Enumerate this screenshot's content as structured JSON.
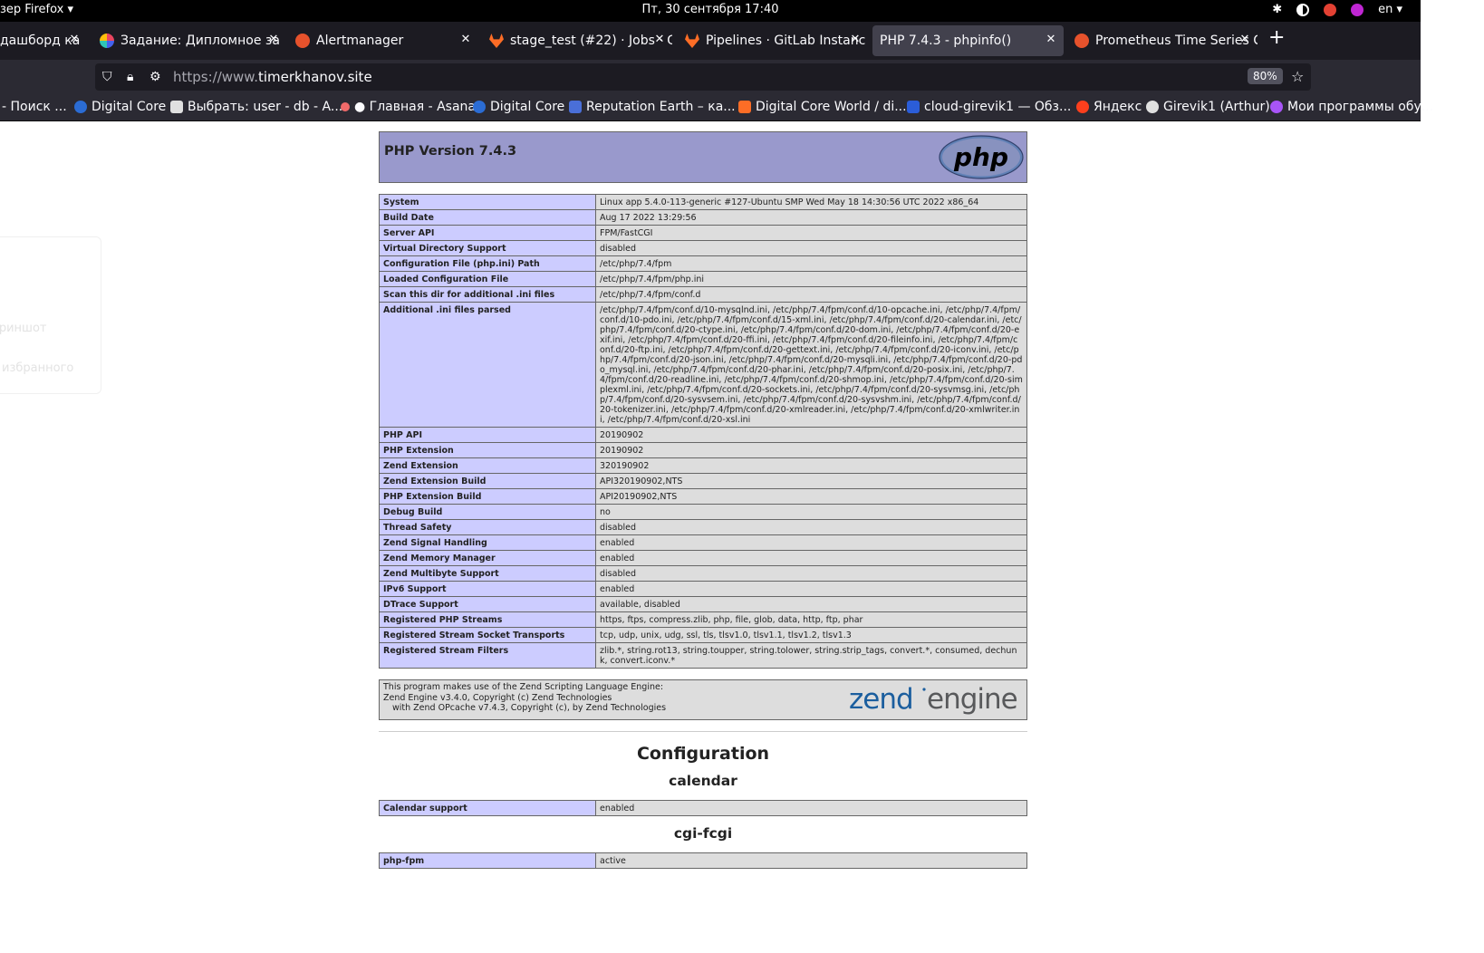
{
  "topbar": {
    "app_name": "зер Firefox ▾",
    "clock": "Пт, 30 сентября  17:40",
    "lang": "en ▾"
  },
  "tabs": [
    {
      "title": "дашборд ка",
      "favicon_color": "#555555"
    },
    {
      "title": "Задание: Дипломное за",
      "favicon_color": "#8a63d2"
    },
    {
      "title": "Alertmanager",
      "favicon_color": "#e6522c"
    },
    {
      "title": "stage_test (#22) · Jobs · G",
      "favicon_color": "#fc6d26"
    },
    {
      "title": "Pipelines · GitLab Instanc",
      "favicon_color": "#fc6d26"
    },
    {
      "title": "PHP 7.4.3 - phpinfo()",
      "favicon_color": ""
    },
    {
      "title": "Prometheus Time Series C",
      "favicon_color": "#e6522c"
    }
  ],
  "navbar": {
    "url_prefix": "https://www.",
    "url_domain": "timerkhanov.site",
    "zoom": "80%"
  },
  "bookmarks": [
    {
      "label": "- Поиск ...",
      "color": ""
    },
    {
      "label": "Digital Core",
      "color": "#2b6cd4"
    },
    {
      "label": "Выбрать: user - db - A...",
      "color": "#e0e0e0"
    },
    {
      "label": "● Главная - Asana",
      "color": "#f06a6a"
    },
    {
      "label": "Digital Core",
      "color": "#2b6cd4"
    },
    {
      "label": "Reputation Earth – ка...",
      "color": "#4a6fd8"
    },
    {
      "label": "Digital Core World / di...",
      "color": "#fc6d26"
    },
    {
      "label": "cloud-girevik1 — Обз...",
      "color": "#2b5dd8"
    },
    {
      "label": "Яндекс",
      "color": "#fc3f1d"
    },
    {
      "label": "Girevik1 (Arthur)",
      "color": "#e0e0e0"
    },
    {
      "label": "Мои программы обу...",
      "color": "#a855f7"
    }
  ],
  "ghost_menu": [
    "о",
    "а",
    "криншот",
    "з избранного"
  ],
  "phpinfo": {
    "version_title": "PHP Version 7.4.3",
    "logo_text": "php",
    "rows": [
      {
        "k": "System",
        "v": "Linux app 5.4.0-113-generic #127-Ubuntu SMP Wed May 18 14:30:56 UTC 2022 x86_64"
      },
      {
        "k": "Build Date",
        "v": "Aug 17 2022 13:29:56"
      },
      {
        "k": "Server API",
        "v": "FPM/FastCGI"
      },
      {
        "k": "Virtual Directory Support",
        "v": "disabled"
      },
      {
        "k": "Configuration File (php.ini) Path",
        "v": "/etc/php/7.4/fpm"
      },
      {
        "k": "Loaded Configuration File",
        "v": "/etc/php/7.4/fpm/php.ini"
      },
      {
        "k": "Scan this dir for additional .ini files",
        "v": "/etc/php/7.4/fpm/conf.d"
      },
      {
        "k": "Additional .ini files parsed",
        "v": "/etc/php/7.4/fpm/conf.d/10-mysqlnd.ini, /etc/php/7.4/fpm/conf.d/10-opcache.ini, /etc/php/7.4/fpm/conf.d/10-pdo.ini, /etc/php/7.4/fpm/conf.d/15-xml.ini, /etc/php/7.4/fpm/conf.d/20-calendar.ini, /etc/php/7.4/fpm/conf.d/20-ctype.ini, /etc/php/7.4/fpm/conf.d/20-dom.ini, /etc/php/7.4/fpm/conf.d/20-exif.ini, /etc/php/7.4/fpm/conf.d/20-ffi.ini, /etc/php/7.4/fpm/conf.d/20-fileinfo.ini, /etc/php/7.4/fpm/conf.d/20-ftp.ini, /etc/php/7.4/fpm/conf.d/20-gettext.ini, /etc/php/7.4/fpm/conf.d/20-iconv.ini, /etc/php/7.4/fpm/conf.d/20-json.ini, /etc/php/7.4/fpm/conf.d/20-mysqli.ini, /etc/php/7.4/fpm/conf.d/20-pdo_mysql.ini, /etc/php/7.4/fpm/conf.d/20-phar.ini, /etc/php/7.4/fpm/conf.d/20-posix.ini, /etc/php/7.4/fpm/conf.d/20-readline.ini, /etc/php/7.4/fpm/conf.d/20-shmop.ini, /etc/php/7.4/fpm/conf.d/20-simplexml.ini, /etc/php/7.4/fpm/conf.d/20-sockets.ini, /etc/php/7.4/fpm/conf.d/20-sysvmsg.ini, /etc/php/7.4/fpm/conf.d/20-sysvsem.ini, /etc/php/7.4/fpm/conf.d/20-sysvshm.ini, /etc/php/7.4/fpm/conf.d/20-tokenizer.ini, /etc/php/7.4/fpm/conf.d/20-xmlreader.ini, /etc/php/7.4/fpm/conf.d/20-xmlwriter.ini, /etc/php/7.4/fpm/conf.d/20-xsl.ini"
      },
      {
        "k": "PHP API",
        "v": "20190902"
      },
      {
        "k": "PHP Extension",
        "v": "20190902"
      },
      {
        "k": "Zend Extension",
        "v": "320190902"
      },
      {
        "k": "Zend Extension Build",
        "v": "API320190902,NTS"
      },
      {
        "k": "PHP Extension Build",
        "v": "API20190902,NTS"
      },
      {
        "k": "Debug Build",
        "v": "no"
      },
      {
        "k": "Thread Safety",
        "v": "disabled"
      },
      {
        "k": "Zend Signal Handling",
        "v": "enabled"
      },
      {
        "k": "Zend Memory Manager",
        "v": "enabled"
      },
      {
        "k": "Zend Multibyte Support",
        "v": "disabled"
      },
      {
        "k": "IPv6 Support",
        "v": "enabled"
      },
      {
        "k": "DTrace Support",
        "v": "available, disabled"
      },
      {
        "k": "Registered PHP Streams",
        "v": "https, ftps, compress.zlib, php, file, glob, data, http, ftp, phar"
      },
      {
        "k": "Registered Stream Socket Transports",
        "v": "tcp, udp, unix, udg, ssl, tls, tlsv1.0, tlsv1.1, tlsv1.2, tlsv1.3"
      },
      {
        "k": "Registered Stream Filters",
        "v": "zlib.*, string.rot13, string.toupper, string.tolower, string.strip_tags, convert.*, consumed, dechunk, convert.iconv.*"
      }
    ],
    "zend": {
      "line1": "This program makes use of the Zend Scripting Language Engine:",
      "line2": "Zend Engine v3.4.0, Copyright (c) Zend Technologies",
      "line3": "with Zend OPcache v7.4.3, Copyright (c), by Zend Technologies",
      "logo_word1": "zend",
      "logo_word2": "engine"
    },
    "configuration_title": "Configuration",
    "modules": [
      {
        "name": "calendar",
        "rows": [
          {
            "k": "Calendar support",
            "v": "enabled"
          }
        ]
      },
      {
        "name": "cgi-fcgi",
        "rows": [
          {
            "k": "php-fpm",
            "v": "active"
          }
        ]
      }
    ]
  }
}
